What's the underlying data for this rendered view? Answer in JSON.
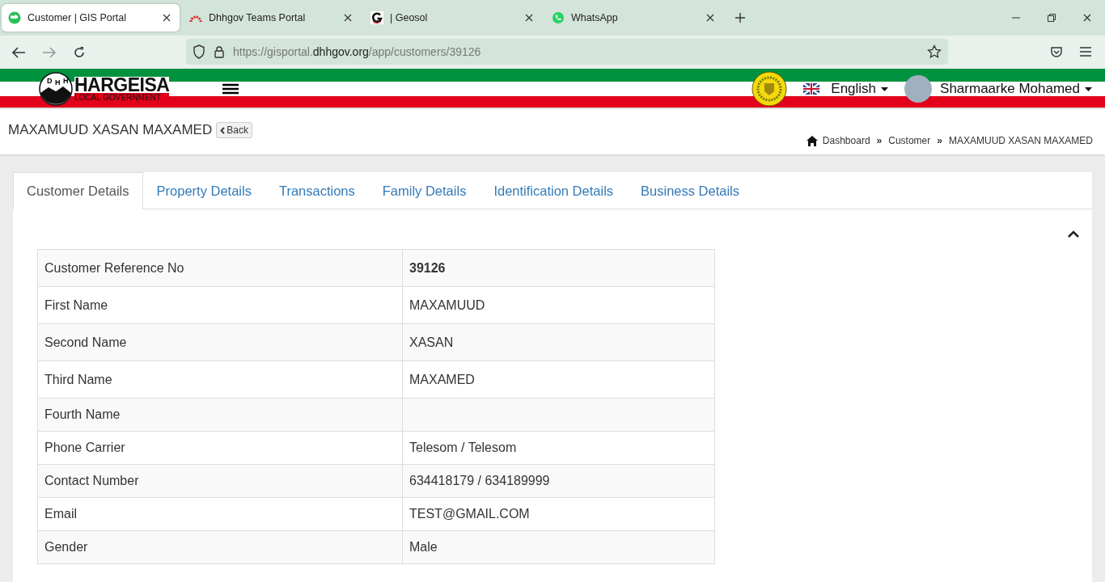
{
  "browser": {
    "tabs": [
      {
        "title": "Customer | GIS Portal",
        "selected": true,
        "kind": "gis"
      },
      {
        "title": "Dhhgov Teams Portal",
        "selected": false,
        "kind": "teams"
      },
      {
        "title": "| Geosol",
        "selected": false,
        "kind": "geosol"
      },
      {
        "title": "WhatsApp",
        "selected": false,
        "kind": "whatsapp"
      }
    ],
    "url": {
      "prefix": "https://gisportal.",
      "domain": "dhhgov.org",
      "path": "/app/customers/39126"
    }
  },
  "header": {
    "logo_title": "HARGEISA",
    "logo_subtitle": "LOCAL GOVERNMENT",
    "logo_letters": [
      "D",
      "H",
      "H"
    ],
    "language": "English",
    "user": "Sharmaarke Mohamed"
  },
  "page": {
    "title": "MAXAMUUD XASAN MAXAMED",
    "back_button": "Back",
    "breadcrumbs": [
      {
        "label": "Dashboard"
      },
      {
        "label": "Customer",
        "separator": "»"
      },
      {
        "label": "MAXAMUUD XASAN MAXAMED",
        "separator": "»"
      }
    ]
  },
  "tabs": [
    {
      "label": "Customer Details",
      "selected": true
    },
    {
      "label": "Property Details",
      "selected": false
    },
    {
      "label": "Transactions",
      "selected": false
    },
    {
      "label": "Family Details",
      "selected": false
    },
    {
      "label": "Identification Details",
      "selected": false
    },
    {
      "label": "Business Details",
      "selected": false
    }
  ],
  "details": {
    "expanded": true,
    "rows": [
      {
        "label": "Customer Reference No",
        "value": "39126",
        "bold": true
      },
      {
        "label": "First Name",
        "value": "MAXAMUUD",
        "bold": false
      },
      {
        "label": "Second Name",
        "value": "XASAN",
        "bold": false
      },
      {
        "label": "Third Name",
        "value": "MAXAMED",
        "bold": false
      },
      {
        "label": "Fourth Name",
        "bold": false
      },
      {
        "label": "Phone Carrier",
        "value": "Telesom / Telesom",
        "bold": false
      },
      {
        "label": "Contact Number",
        "value": "634418179 / 634189999",
        "bold": false
      },
      {
        "label": "Email",
        "value": "TEST@GMAIL.COM",
        "bold": false
      },
      {
        "label": "Gender",
        "value": "Male",
        "bold": false
      }
    ]
  }
}
